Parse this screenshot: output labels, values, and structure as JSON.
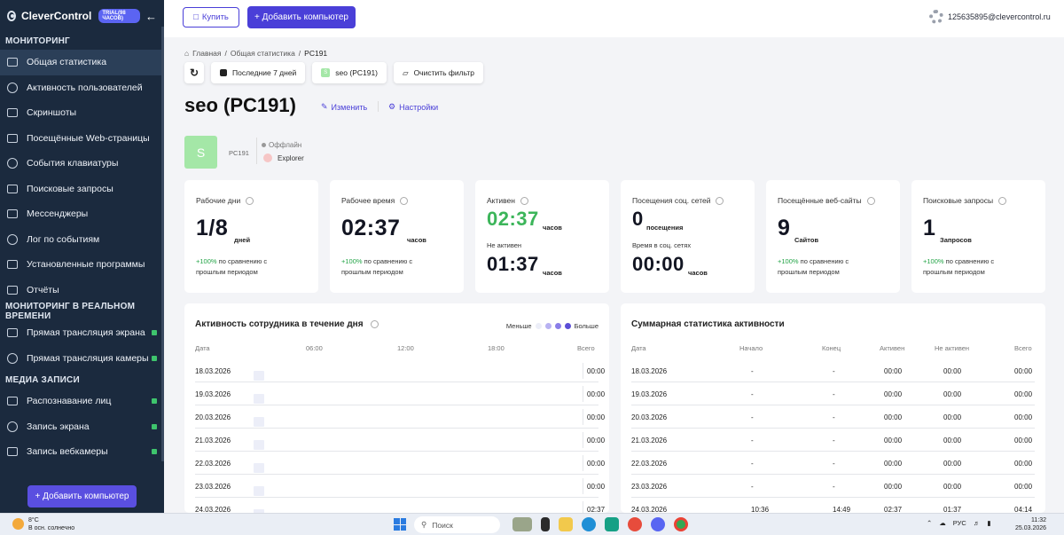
{
  "sidebar": {
    "brand": "CleverControl",
    "trial": "TRIAL(98 ЧАСОВ)",
    "sec_monitoring": "МОНИТОРИНГ",
    "items_monitoring": [
      "Общая статистика",
      "Активность пользователей",
      "Скриншоты",
      "Посещённые Web-страницы",
      "События клавиатуры",
      "Поисковые запросы",
      "Мессенджеры",
      "Лог по событиям",
      "Установленные программы",
      "Отчёты"
    ],
    "sec_realtime": "МОНИТОРИНГ В РЕАЛЬНОМ ВРЕМЕНИ",
    "items_realtime": [
      "Прямая трансляция экрана",
      "Прямая трансляция камеры"
    ],
    "sec_media": "МЕДИА ЗАПИСИ",
    "items_media": [
      "Распознавание лиц",
      "Запись экрана",
      "Запись вебкамеры"
    ],
    "add_button": "+ Добавить компьютер"
  },
  "header": {
    "buy": "Купить",
    "add_computer": "+ Добавить компьютер",
    "email": "125635895@clevercontrol.ru"
  },
  "breadcrumb": [
    "Главная",
    "Общая статистика",
    "PC191"
  ],
  "filters": {
    "period": "Последние 7 дней",
    "computer": "seo (PC191)",
    "clear": "Очистить фильтр"
  },
  "page": {
    "title": "seo (PC191)",
    "edit": "Изменить",
    "settings": "Настройки",
    "avatar_letter": "S",
    "pc": "PC191",
    "status": "Оффлайн",
    "app": "Explorer"
  },
  "cards": {
    "workdays": {
      "label": "Рабочие дни",
      "value": "1/8",
      "unit": "дней",
      "cmp_pct": "+100%",
      "cmp_txt1": "по сравнению с",
      "cmp_txt2": "прошлым периодом"
    },
    "worktime": {
      "label": "Рабочее время",
      "value": "02:37",
      "unit": "часов",
      "cmp_pct": "+100%",
      "cmp_txt1": "по сравнению с",
      "cmp_txt2": "прошлым периодом"
    },
    "active": {
      "label": "Активен",
      "value": "02:37",
      "unit": "часов",
      "inactive_label": "Не активен",
      "inactive_value": "01:37",
      "inactive_unit": "часов"
    },
    "social": {
      "label": "Посещения соц. сетей",
      "value": "0",
      "unit": "посещения",
      "time_label": "Время в соц. сетях",
      "time_value": "00:00",
      "time_unit": "часов"
    },
    "sites": {
      "label": "Посещённые веб-сайты",
      "value": "9",
      "unit": "Сайтов",
      "cmp_pct": "+100%",
      "cmp_txt1": "по сравнению с",
      "cmp_txt2": "прошлым периодом"
    },
    "searches": {
      "label": "Поисковые запросы",
      "value": "1",
      "unit": "Запросов",
      "cmp_pct": "+100%",
      "cmp_txt1": "по сравнению с",
      "cmp_txt2": "прошлым периодом"
    }
  },
  "activity": {
    "title": "Активность сотрудника в течение дня",
    "less": "Меньше",
    "more": "Больше",
    "col_date": "Дата",
    "col_total": "Всего",
    "hours": [
      "06:00",
      "12:00",
      "18:00"
    ],
    "rows": [
      {
        "date": "18.03.2026",
        "total": "00:00",
        "levels": []
      },
      {
        "date": "19.03.2026",
        "total": "00:00",
        "levels": []
      },
      {
        "date": "20.03.2026",
        "total": "00:00",
        "levels": []
      },
      {
        "date": "21.03.2026",
        "total": "00:00",
        "levels": []
      },
      {
        "date": "22.03.2026",
        "total": "00:00",
        "levels": []
      },
      {
        "date": "23.03.2026",
        "total": "00:00",
        "levels": []
      },
      {
        "date": "24.03.2026",
        "total": "02:37",
        "cells": [
          {
            "i": 10,
            "v": "16",
            "l": 1
          },
          {
            "i": 11,
            "v": "37",
            "l": 2
          },
          {
            "i": 12,
            "v": "49",
            "l": 3
          },
          {
            "i": 13,
            "v": "35",
            "l": 2
          },
          {
            "i": 14,
            "v": "21",
            "l": 1
          }
        ]
      }
    ]
  },
  "summary": {
    "title": "Суммарная статистика активности",
    "headers": [
      "Дата",
      "Начало",
      "Конец",
      "Активен",
      "Не активен",
      "Всего"
    ],
    "rows": [
      [
        "18.03.2026",
        "-",
        "-",
        "00:00",
        "00:00",
        "00:00"
      ],
      [
        "19.03.2026",
        "-",
        "-",
        "00:00",
        "00:00",
        "00:00"
      ],
      [
        "20.03.2026",
        "-",
        "-",
        "00:00",
        "00:00",
        "00:00"
      ],
      [
        "21.03.2026",
        "-",
        "-",
        "00:00",
        "00:00",
        "00:00"
      ],
      [
        "22.03.2026",
        "-",
        "-",
        "00:00",
        "00:00",
        "00:00"
      ],
      [
        "23.03.2026",
        "-",
        "-",
        "00:00",
        "00:00",
        "00:00"
      ],
      [
        "24.03.2026",
        "10:36",
        "14:49",
        "02:37",
        "01:37",
        "04:14"
      ]
    ]
  },
  "taskbar": {
    "temp": "8°C",
    "weather": "В осн. солнечно",
    "search": "Поиск",
    "lang": "РУС",
    "time": "11:32",
    "date": "25.03.2026"
  }
}
